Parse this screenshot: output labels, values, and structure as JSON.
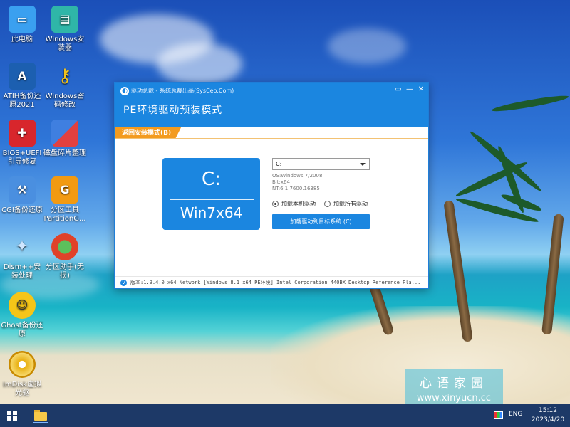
{
  "desktop": {
    "icons": [
      {
        "label": "此电脑",
        "icon": "computer-icon",
        "color": "#3aa0f0"
      },
      {
        "label": "Windows安装器",
        "icon": "installer-icon",
        "color": "#2fb6a8"
      },
      {
        "label": "ATIH备份还原2021",
        "icon": "acronis-icon",
        "color": "#1c5fb0"
      },
      {
        "label": "Windows密码修改",
        "icon": "key-icon",
        "color": "#f2c21a"
      },
      {
        "label": "BIOS+UEFI引导修复",
        "icon": "toolbox-icon",
        "color": "#d8262c"
      },
      {
        "label": "磁盘碎片整理",
        "icon": "defrag-icon",
        "color": "#3f7fe0"
      },
      {
        "label": "CGI备份还原",
        "icon": "cgi-icon",
        "color": "#4a8fe0"
      },
      {
        "label": "分区工具PartitionG...",
        "icon": "partition-icon",
        "color": "#f29a12"
      },
      {
        "label": "Dism++安装处理",
        "icon": "dism-icon",
        "color": "#2e7bd6"
      },
      {
        "label": "分区助手(无损)",
        "icon": "partition-assistant-icon",
        "color": "#e0422a"
      },
      {
        "label": "Ghost备份还原",
        "icon": "ghost-icon",
        "color": "#f5c518"
      },
      {
        "label": "ImDisk虚拟光驱",
        "icon": "disc-icon",
        "color": "#e8b012"
      }
    ]
  },
  "dialog": {
    "app_title": "驱动总裁 - 系统总裁出品(SysCeo.Com)",
    "heading": "PE环境驱动预装模式",
    "back_tag": "返回安装模式(B)",
    "drive_letter": "C:",
    "drive_os": "Win7x64",
    "drive_select_value": "C:",
    "info_os": "OS:Windows 7/2008",
    "info_bit": "Bit:x64",
    "info_nt": "NT:6.1.7600.16385",
    "radio_local": "加载本机驱动",
    "radio_all": "加载所有驱动",
    "radio_selected": "local",
    "load_button": "加载驱动到目标系统 (C)",
    "version_icon_text": "V",
    "version_text": "版本:1.9.4.0_x64_Network [Windows 8.1 x64 PE环境] Intel Corporation_440BX Desktop Reference Pla..."
  },
  "watermark": {
    "cn": "心语家园",
    "url": "www.xinyucn.cc"
  },
  "taskbar": {
    "lang": "ENG",
    "time": "15:12",
    "date": "2023/4/20"
  },
  "colors": {
    "accent": "#1b86e0",
    "back_tag": "#f39b1f",
    "taskbar": "#0a285a"
  }
}
